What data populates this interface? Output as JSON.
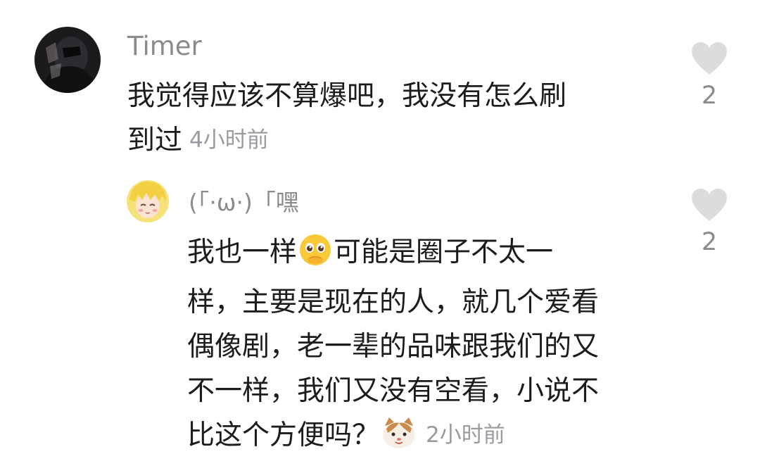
{
  "comments": [
    {
      "username": "Timer",
      "text_lines": [
        "我觉得应该不算爆吧，我没有怎么刷",
        "到过"
      ],
      "timestamp": "4小时前",
      "likes": "2",
      "avatar_icon": "dark-portrait-avatar"
    }
  ],
  "reply": {
    "username": "(「·ω·)「嘿",
    "text_line1_a": "我也一样",
    "text_line1_emoji": "pleading-face-emoji",
    "text_line1_b": "可能是圈子不太一",
    "text_lines_rest": [
      "样，主要是现在的人，就几个爱看",
      "偶像剧，老一辈的品味跟我们的又",
      "不一样，我们又没有空看，小说不"
    ],
    "text_last": "比这个方便吗？",
    "text_last_emoji": "cat-face-emoji",
    "timestamp": "2小时前",
    "likes": "2",
    "avatar_icon": "blonde-anime-avatar"
  },
  "colors": {
    "text": "#1c1c1e",
    "secondary": "#8a8a8f",
    "heart": "#dcdcdc"
  }
}
